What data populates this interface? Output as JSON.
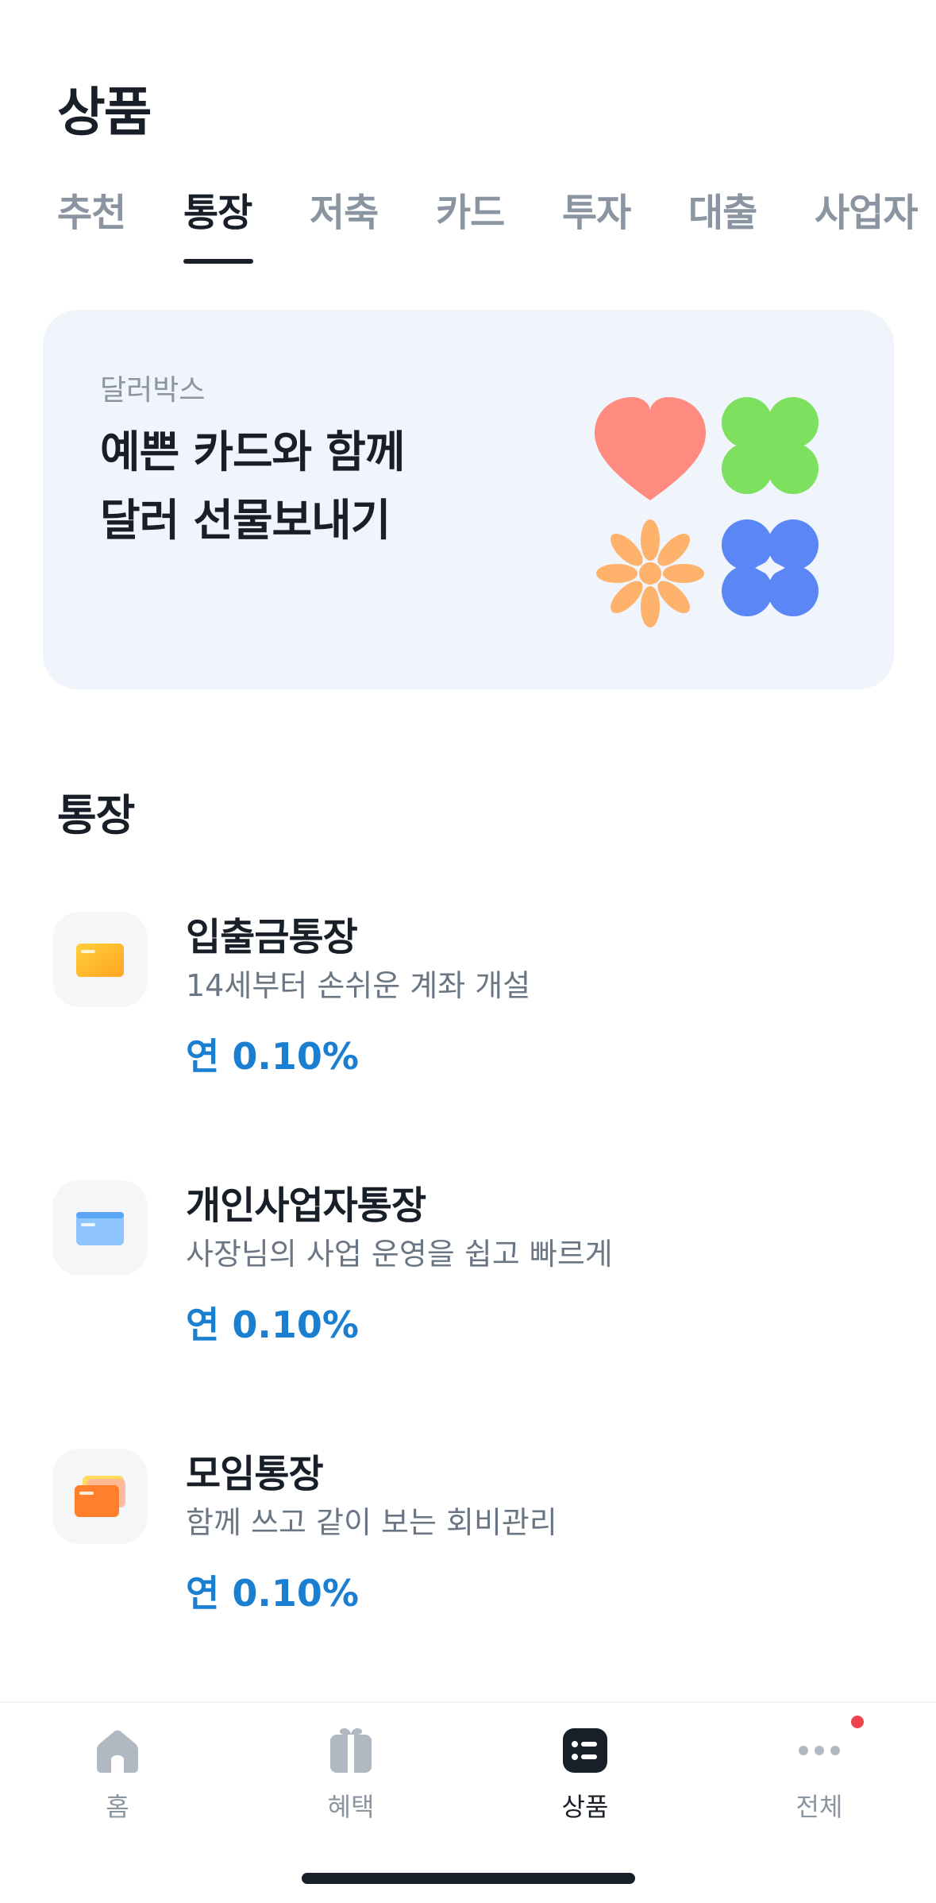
{
  "header": {
    "title": "상품"
  },
  "tabs": [
    "추천",
    "통장",
    "저축",
    "카드",
    "투자",
    "대출",
    "사업자"
  ],
  "active_tab": "통장",
  "banner": {
    "eyebrow": "달러박스",
    "title_line1": "예쁜 카드와 함께",
    "title_line2": "달러 선물보내기",
    "art_icons": [
      "heart-icon",
      "clover-icon",
      "flower-icon",
      "four-leaf-icon"
    ],
    "colors": {
      "heart": "#ff8a80",
      "clover": "#7de05e",
      "flower": "#ffb26b",
      "blue": "#5b86f5"
    }
  },
  "section": {
    "title": "통장"
  },
  "products": [
    {
      "name": "입출금통장",
      "desc": "14세부터 손쉬운 계좌 개설",
      "rate": "연 0.10%",
      "icon": "yellow-card-icon"
    },
    {
      "name": "개인사업자통장",
      "desc": "사장님의 사업 운영을 쉽고 빠르게",
      "rate": "연 0.10%",
      "icon": "blue-card-icon"
    },
    {
      "name": "모임통장",
      "desc": "함께 쓰고 같이 보는 회비관리",
      "rate": "연 0.10%",
      "icon": "stacked-cards-icon"
    }
  ],
  "nav": [
    {
      "label": "홈",
      "icon": "home-icon"
    },
    {
      "label": "혜택",
      "icon": "gift-icon"
    },
    {
      "label": "상품",
      "icon": "list-icon",
      "active": true
    },
    {
      "label": "전체",
      "icon": "more-icon",
      "badge": true
    }
  ],
  "accent_color": "#1b7fd1"
}
